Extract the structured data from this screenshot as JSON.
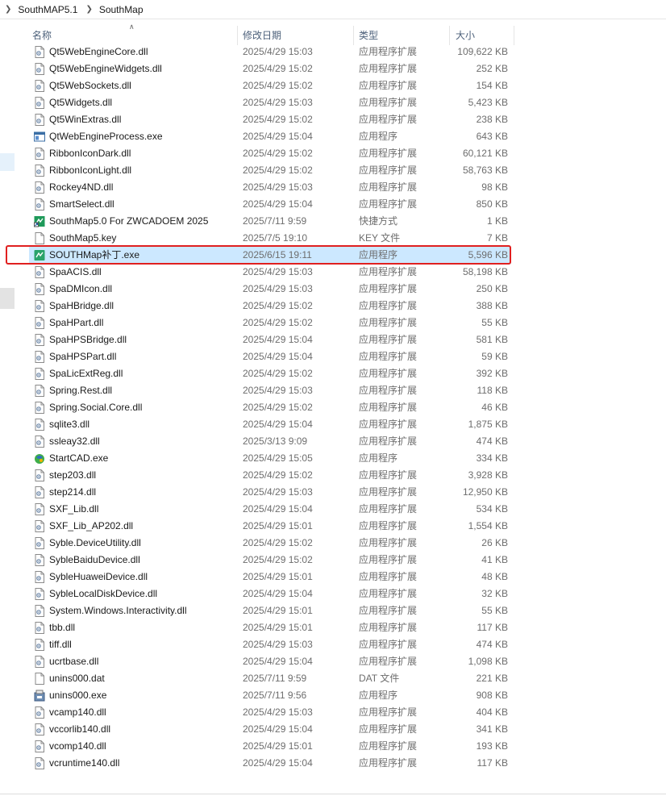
{
  "breadcrumb": {
    "items": [
      "SouthMAP5.1",
      "SouthMap"
    ]
  },
  "headers": {
    "name": "名称",
    "date": "修改日期",
    "type": "类型",
    "size": "大小"
  },
  "files": [
    {
      "name": "Qt5WebEngineCore.dll",
      "date": "2025/4/29 15:03",
      "type": "应用程序扩展",
      "size": "109,622 KB",
      "icon": "dll-icon"
    },
    {
      "name": "Qt5WebEngineWidgets.dll",
      "date": "2025/4/29 15:02",
      "type": "应用程序扩展",
      "size": "252 KB",
      "icon": "dll-icon"
    },
    {
      "name": "Qt5WebSockets.dll",
      "date": "2025/4/29 15:02",
      "type": "应用程序扩展",
      "size": "154 KB",
      "icon": "dll-icon"
    },
    {
      "name": "Qt5Widgets.dll",
      "date": "2025/4/29 15:03",
      "type": "应用程序扩展",
      "size": "5,423 KB",
      "icon": "dll-icon"
    },
    {
      "name": "Qt5WinExtras.dll",
      "date": "2025/4/29 15:02",
      "type": "应用程序扩展",
      "size": "238 KB",
      "icon": "dll-icon"
    },
    {
      "name": "QtWebEngineProcess.exe",
      "date": "2025/4/29 15:04",
      "type": "应用程序",
      "size": "643 KB",
      "icon": "window-exe-icon"
    },
    {
      "name": "RibbonIconDark.dll",
      "date": "2025/4/29 15:02",
      "type": "应用程序扩展",
      "size": "60,121 KB",
      "icon": "dll-icon"
    },
    {
      "name": "RibbonIconLight.dll",
      "date": "2025/4/29 15:02",
      "type": "应用程序扩展",
      "size": "58,763 KB",
      "icon": "dll-icon"
    },
    {
      "name": "Rockey4ND.dll",
      "date": "2025/4/29 15:03",
      "type": "应用程序扩展",
      "size": "98 KB",
      "icon": "dll-icon"
    },
    {
      "name": "SmartSelect.dll",
      "date": "2025/4/29 15:04",
      "type": "应用程序扩展",
      "size": "850 KB",
      "icon": "dll-icon"
    },
    {
      "name": "SouthMap5.0 For ZWCADOEM 2025",
      "date": "2025/7/11 9:59",
      "type": "快捷方式",
      "size": "1 KB",
      "icon": "southmap-shortcut-icon"
    },
    {
      "name": "SouthMap5.key",
      "date": "2025/7/5 19:10",
      "type": "KEY 文件",
      "size": "7 KB",
      "icon": "blank-file-icon"
    },
    {
      "name": "SOUTHMap补丁.exe",
      "date": "2025/6/15 19:11",
      "type": "应用程序",
      "size": "5,596 KB",
      "icon": "southmap-exe-icon"
    },
    {
      "name": "SpaACIS.dll",
      "date": "2025/4/29 15:03",
      "type": "应用程序扩展",
      "size": "58,198 KB",
      "icon": "dll-icon"
    },
    {
      "name": "SpaDMIcon.dll",
      "date": "2025/4/29 15:03",
      "type": "应用程序扩展",
      "size": "250 KB",
      "icon": "dll-icon"
    },
    {
      "name": "SpaHBridge.dll",
      "date": "2025/4/29 15:02",
      "type": "应用程序扩展",
      "size": "388 KB",
      "icon": "dll-icon"
    },
    {
      "name": "SpaHPart.dll",
      "date": "2025/4/29 15:02",
      "type": "应用程序扩展",
      "size": "55 KB",
      "icon": "dll-icon"
    },
    {
      "name": "SpaHPSBridge.dll",
      "date": "2025/4/29 15:04",
      "type": "应用程序扩展",
      "size": "581 KB",
      "icon": "dll-icon"
    },
    {
      "name": "SpaHPSPart.dll",
      "date": "2025/4/29 15:04",
      "type": "应用程序扩展",
      "size": "59 KB",
      "icon": "dll-icon"
    },
    {
      "name": "SpaLicExtReg.dll",
      "date": "2025/4/29 15:02",
      "type": "应用程序扩展",
      "size": "392 KB",
      "icon": "dll-icon"
    },
    {
      "name": "Spring.Rest.dll",
      "date": "2025/4/29 15:03",
      "type": "应用程序扩展",
      "size": "118 KB",
      "icon": "dll-icon"
    },
    {
      "name": "Spring.Social.Core.dll",
      "date": "2025/4/29 15:02",
      "type": "应用程序扩展",
      "size": "46 KB",
      "icon": "dll-icon"
    },
    {
      "name": "sqlite3.dll",
      "date": "2025/4/29 15:04",
      "type": "应用程序扩展",
      "size": "1,875 KB",
      "icon": "dll-icon"
    },
    {
      "name": "ssleay32.dll",
      "date": "2025/3/13 9:09",
      "type": "应用程序扩展",
      "size": "474 KB",
      "icon": "dll-icon"
    },
    {
      "name": "StartCAD.exe",
      "date": "2025/4/29 15:05",
      "type": "应用程序",
      "size": "334 KB",
      "icon": "startcad-exe-icon"
    },
    {
      "name": "step203.dll",
      "date": "2025/4/29 15:02",
      "type": "应用程序扩展",
      "size": "3,928 KB",
      "icon": "dll-icon"
    },
    {
      "name": "step214.dll",
      "date": "2025/4/29 15:03",
      "type": "应用程序扩展",
      "size": "12,950 KB",
      "icon": "dll-icon"
    },
    {
      "name": "SXF_Lib.dll",
      "date": "2025/4/29 15:04",
      "type": "应用程序扩展",
      "size": "534 KB",
      "icon": "dll-icon"
    },
    {
      "name": "SXF_Lib_AP202.dll",
      "date": "2025/4/29 15:01",
      "type": "应用程序扩展",
      "size": "1,554 KB",
      "icon": "dll-icon"
    },
    {
      "name": "Syble.DeviceUtility.dll",
      "date": "2025/4/29 15:02",
      "type": "应用程序扩展",
      "size": "26 KB",
      "icon": "dll-icon"
    },
    {
      "name": "SybleBaiduDevice.dll",
      "date": "2025/4/29 15:02",
      "type": "应用程序扩展",
      "size": "41 KB",
      "icon": "dll-icon"
    },
    {
      "name": "SybleHuaweiDevice.dll",
      "date": "2025/4/29 15:01",
      "type": "应用程序扩展",
      "size": "48 KB",
      "icon": "dll-icon"
    },
    {
      "name": "SybleLocalDiskDevice.dll",
      "date": "2025/4/29 15:04",
      "type": "应用程序扩展",
      "size": "32 KB",
      "icon": "dll-icon"
    },
    {
      "name": "System.Windows.Interactivity.dll",
      "date": "2025/4/29 15:01",
      "type": "应用程序扩展",
      "size": "55 KB",
      "icon": "dll-icon"
    },
    {
      "name": "tbb.dll",
      "date": "2025/4/29 15:01",
      "type": "应用程序扩展",
      "size": "117 KB",
      "icon": "dll-icon"
    },
    {
      "name": "tiff.dll",
      "date": "2025/4/29 15:03",
      "type": "应用程序扩展",
      "size": "474 KB",
      "icon": "dll-icon"
    },
    {
      "name": "ucrtbase.dll",
      "date": "2025/4/29 15:04",
      "type": "应用程序扩展",
      "size": "1,098 KB",
      "icon": "dll-icon"
    },
    {
      "name": "unins000.dat",
      "date": "2025/7/11 9:59",
      "type": "DAT 文件",
      "size": "221 KB",
      "icon": "blank-file-icon"
    },
    {
      "name": "unins000.exe",
      "date": "2025/7/11 9:56",
      "type": "应用程序",
      "size": "908 KB",
      "icon": "installer-exe-icon"
    },
    {
      "name": "vcamp140.dll",
      "date": "2025/4/29 15:03",
      "type": "应用程序扩展",
      "size": "404 KB",
      "icon": "dll-icon"
    },
    {
      "name": "vccorlib140.dll",
      "date": "2025/4/29 15:04",
      "type": "应用程序扩展",
      "size": "341 KB",
      "icon": "dll-icon"
    },
    {
      "name": "vcomp140.dll",
      "date": "2025/4/29 15:01",
      "type": "应用程序扩展",
      "size": "193 KB",
      "icon": "dll-icon"
    },
    {
      "name": "vcruntime140.dll",
      "date": "2025/4/29 15:04",
      "type": "应用程序扩展",
      "size": "117 KB",
      "icon": "dll-icon"
    }
  ],
  "selected_file": "SOUTHMap补丁.exe",
  "colors": {
    "selection": "#cce8ff",
    "highlight_border": "#e02020",
    "header_text": "#4c607a"
  }
}
